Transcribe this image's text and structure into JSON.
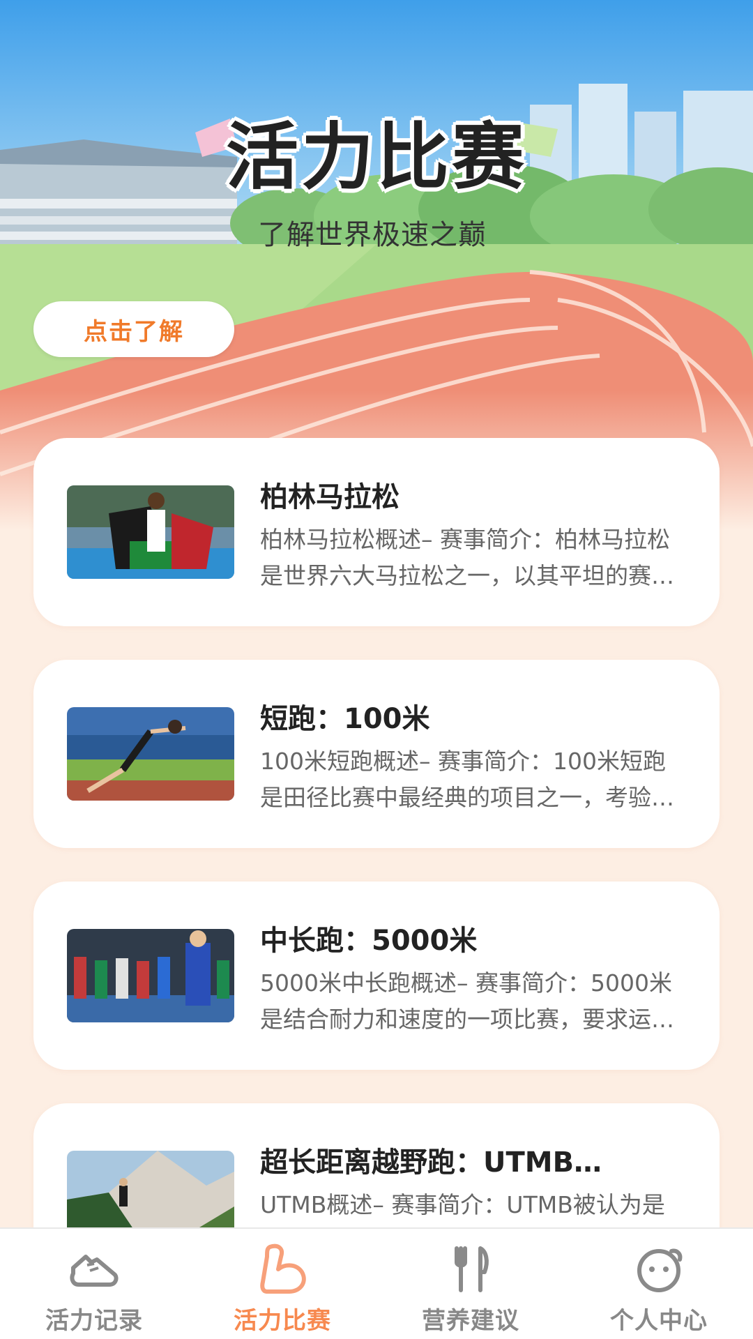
{
  "hero": {
    "title": "活力比赛",
    "subtitle": "了解世界极速之巅",
    "cta_label": "点击了解"
  },
  "events": [
    {
      "title": "柏林马拉松",
      "description": "柏林马拉松概述– 赛事简介：柏林马拉松是世界六大马拉松之一，以其平坦的赛道和快速的成绩而闻名",
      "image": "marathon-runner-with-flag"
    },
    {
      "title": "短跑：100米",
      "description": "100米短跑概述– 赛事简介：100米短跑是田径比赛中最经典的项目之一，考验运动员的爆发力",
      "image": "sprinter-on-track"
    },
    {
      "title": "中长跑：5000米",
      "description": "5000米中长跑概述– 赛事简介：5000米是结合耐力和速度的一项比赛，要求运动员合理分配体力",
      "image": "distance-runners-group"
    },
    {
      "title": "超长距离越野跑：UTMB…",
      "description": "UTMB概述– 赛事简介：UTMB被认为是世界上最具挑战性的越野跑赛事之一",
      "image": "trail-runner-mountains"
    }
  ],
  "tabs": [
    {
      "label": "活力记录",
      "icon": "running-shoe-icon",
      "active": false
    },
    {
      "label": "活力比赛",
      "icon": "flexed-arm-icon",
      "active": true
    },
    {
      "label": "营养建议",
      "icon": "fork-knife-icon",
      "active": false
    },
    {
      "label": "个人中心",
      "icon": "smiley-face-icon",
      "active": false
    }
  ],
  "colors": {
    "accent": "#f7894f",
    "cta_text": "#f07a2a",
    "page_bg": "#fdeee3",
    "track": "#ef8e76",
    "sky": "#4aa8ec"
  }
}
